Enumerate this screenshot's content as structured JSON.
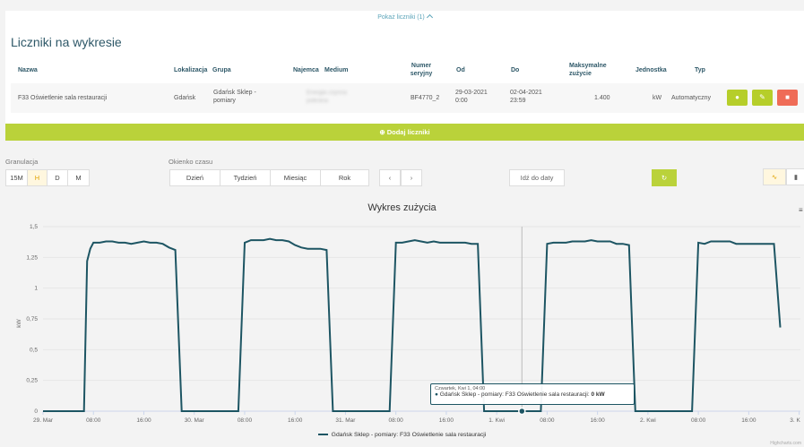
{
  "panel": {
    "toggle_label": "Pokaż liczniki (1)",
    "title": "Liczniki na wykresie",
    "columns": {
      "name": "Nazwa",
      "location": "Lokalizacja",
      "group": "Grupa",
      "tenant": "Najemca",
      "medium": "Medium",
      "serial": "Numer seryjny",
      "from": "Od",
      "to": "Do",
      "max_usage": "Maksymalne zużycie",
      "unit": "Jednostka",
      "type": "Typ"
    },
    "row": {
      "name": "F33 Oświetlenie sala restauracji",
      "location": "Gdańsk",
      "group": "Gdańsk Sklep - pomiary",
      "medium": "Energia czynna pobrana",
      "serial": "BF4770_2",
      "from": "29-03-2021 0:00",
      "to": "02-04-2021 23:59",
      "max_usage": "1.400",
      "unit": "kW",
      "type": "Automatyczny"
    },
    "add_label": "Dodaj liczniki"
  },
  "controls": {
    "granulation_label": "Granulacja",
    "granulation_options": [
      "15M",
      "H",
      "D",
      "M"
    ],
    "granulation_selected": "H",
    "window_label": "Okienko czasu",
    "window_options": [
      "Dzień",
      "Tydzień",
      "Miesiąc",
      "Rok"
    ],
    "goto_date": "Idź do daty"
  },
  "colors": {
    "accent": "#bad23a",
    "danger": "#ef6c57",
    "series": "#1d5563",
    "title": "#2e5868"
  },
  "icons": [
    "chevron-up-icon",
    "info-icon",
    "edit-icon",
    "trash-icon",
    "plus-circle-icon",
    "chevron-left-icon",
    "chevron-right-icon",
    "refresh-icon",
    "line-chart-icon",
    "bar-chart-icon",
    "menu-icon"
  ],
  "tooltip": {
    "date": "Czwartek, Kwi 1, 04:00",
    "series": "Gdańsk Sklep - pomiary: F33 Oświetlenie sala restauracji:",
    "value": "0 kW"
  },
  "credits": "Highcharts.com",
  "chart_data": {
    "type": "line",
    "title": "Wykres zużycia",
    "ylabel": "kW",
    "ylim": [
      0,
      1.5
    ],
    "yticks": [
      "0",
      "0,25",
      "0,5",
      "0,75",
      "1",
      "1,25",
      "1,5"
    ],
    "xticks": [
      "29. Mar",
      "08:00",
      "16:00",
      "30. Mar",
      "08:00",
      "16:00",
      "31. Mar",
      "08:00",
      "16:00",
      "1. Kwi",
      "08:00",
      "16:00",
      "2. Kwi",
      "08:00",
      "16:00",
      "3. K"
    ],
    "x_unit": "hours since 29. Mar 00:00",
    "crosshair_x": 76,
    "series": [
      {
        "name": "Gdańsk Sklep - pomiary: F33 Oświetlenie sala restauracji",
        "points": [
          [
            0,
            0
          ],
          [
            6,
            0
          ],
          [
            6.5,
            0
          ],
          [
            7,
            1.22
          ],
          [
            7.5,
            1.32
          ],
          [
            8,
            1.37
          ],
          [
            9,
            1.37
          ],
          [
            10,
            1.38
          ],
          [
            11,
            1.38
          ],
          [
            12,
            1.37
          ],
          [
            13,
            1.37
          ],
          [
            14,
            1.36
          ],
          [
            15,
            1.37
          ],
          [
            16,
            1.38
          ],
          [
            17,
            1.37
          ],
          [
            18,
            1.37
          ],
          [
            19,
            1.36
          ],
          [
            20,
            1.33
          ],
          [
            21,
            1.31
          ],
          [
            22,
            0
          ],
          [
            24,
            0
          ],
          [
            30,
            0
          ],
          [
            31,
            0
          ],
          [
            32,
            1.37
          ],
          [
            33,
            1.39
          ],
          [
            34,
            1.39
          ],
          [
            35,
            1.39
          ],
          [
            36,
            1.4
          ],
          [
            37,
            1.39
          ],
          [
            38,
            1.39
          ],
          [
            39,
            1.38
          ],
          [
            40,
            1.35
          ],
          [
            41,
            1.33
          ],
          [
            42,
            1.32
          ],
          [
            43,
            1.32
          ],
          [
            44,
            1.32
          ],
          [
            45,
            1.31
          ],
          [
            46,
            0
          ],
          [
            48,
            0
          ],
          [
            54,
            0
          ],
          [
            55,
            0
          ],
          [
            56,
            1.37
          ],
          [
            57,
            1.37
          ],
          [
            58,
            1.38
          ],
          [
            59,
            1.39
          ],
          [
            60,
            1.38
          ],
          [
            61,
            1.37
          ],
          [
            62,
            1.38
          ],
          [
            63,
            1.37
          ],
          [
            64,
            1.37
          ],
          [
            65,
            1.37
          ],
          [
            66,
            1.37
          ],
          [
            67,
            1.37
          ],
          [
            68,
            1.36
          ],
          [
            69,
            1.36
          ],
          [
            70,
            0
          ],
          [
            72,
            0
          ],
          [
            78,
            0
          ],
          [
            79,
            0
          ],
          [
            80,
            1.36
          ],
          [
            81,
            1.37
          ],
          [
            82,
            1.37
          ],
          [
            83,
            1.37
          ],
          [
            84,
            1.38
          ],
          [
            85,
            1.38
          ],
          [
            86,
            1.38
          ],
          [
            87,
            1.39
          ],
          [
            88,
            1.38
          ],
          [
            89,
            1.38
          ],
          [
            90,
            1.38
          ],
          [
            91,
            1.36
          ],
          [
            92,
            1.36
          ],
          [
            93,
            1.35
          ],
          [
            94,
            0
          ],
          [
            96,
            0
          ],
          [
            102,
            0
          ],
          [
            103,
            0
          ],
          [
            104,
            1.37
          ],
          [
            105,
            1.36
          ],
          [
            106,
            1.38
          ],
          [
            107,
            1.38
          ],
          [
            108,
            1.38
          ],
          [
            109,
            1.38
          ],
          [
            110,
            1.36
          ],
          [
            111,
            1.36
          ],
          [
            112,
            1.36
          ],
          [
            113,
            1.36
          ],
          [
            114,
            1.36
          ],
          [
            115,
            1.36
          ],
          [
            116,
            1.36
          ],
          [
            117,
            0.68
          ]
        ]
      }
    ]
  }
}
